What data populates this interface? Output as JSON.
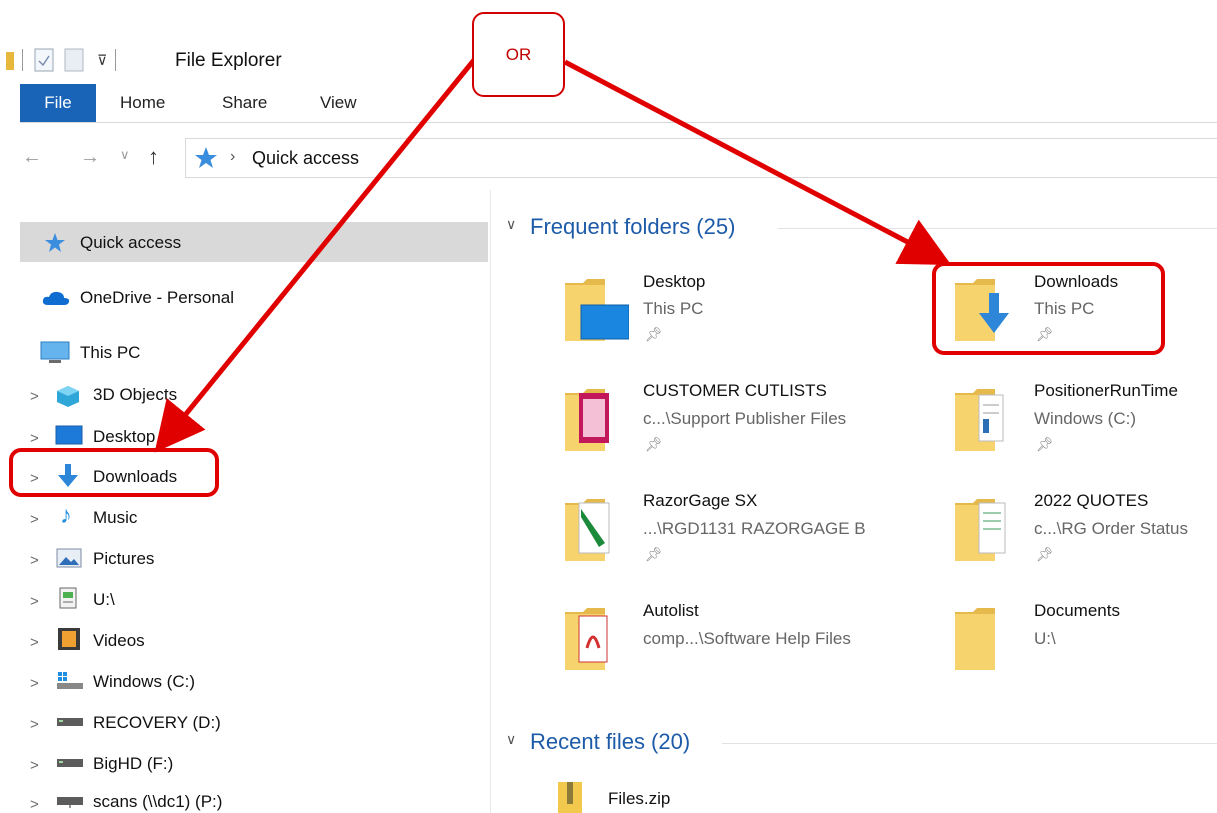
{
  "window": {
    "title": "File Explorer"
  },
  "ribbon": {
    "tabs": [
      "File",
      "Home",
      "Share",
      "View"
    ]
  },
  "address": {
    "path": "Quick access",
    "separator": "›"
  },
  "nav_pane": {
    "quick_access": "Quick access",
    "onedrive": "OneDrive - Personal",
    "this_pc": "This PC",
    "items": [
      {
        "label": "3D Objects",
        "icon": "3d-objects-icon"
      },
      {
        "label": "Desktop",
        "icon": "desktop-icon"
      },
      {
        "label": "Downloads",
        "icon": "downloads-icon"
      },
      {
        "label": "Music",
        "icon": "music-icon"
      },
      {
        "label": "Pictures",
        "icon": "pictures-icon"
      },
      {
        "label": "U:\\",
        "icon": "network-drive-icon"
      },
      {
        "label": "Videos",
        "icon": "videos-icon"
      },
      {
        "label": "Windows (C:)",
        "icon": "windows-drive-icon"
      },
      {
        "label": "RECOVERY (D:)",
        "icon": "drive-icon"
      },
      {
        "label": "BigHD (F:)",
        "icon": "drive-icon"
      },
      {
        "label": "scans (\\\\dc1) (P:)",
        "icon": "network-drive-icon"
      }
    ]
  },
  "frequent_folders": {
    "title": "Frequent folders (25)",
    "items": [
      {
        "name": "Desktop",
        "location": "This PC",
        "pinned": true,
        "overlay": "desktop"
      },
      {
        "name": "Downloads",
        "location": "This PC",
        "pinned": true,
        "overlay": "download-arrow"
      },
      {
        "name": "CUSTOMER CUTLISTS",
        "location": "c...\\Support Publisher Files",
        "pinned": true,
        "overlay": "publisher"
      },
      {
        "name": "PositionerRunTime",
        "location": "Windows (C:)",
        "pinned": true,
        "overlay": "document"
      },
      {
        "name": "RazorGage SX",
        "location": "...\\RGD1131 RAZORGAGE B",
        "pinned": true,
        "overlay": "image"
      },
      {
        "name": "2022 QUOTES",
        "location": "c...\\RG Order Status",
        "pinned": true,
        "overlay": "sheet"
      },
      {
        "name": "Autolist",
        "location": "comp...\\Software Help Files",
        "pinned": false,
        "overlay": "pdf"
      },
      {
        "name": "Documents",
        "location": "U:\\",
        "pinned": false,
        "overlay": "none"
      }
    ]
  },
  "recent_files": {
    "title": "Recent files (20)",
    "items": [
      {
        "name": "Files.zip",
        "icon": "zip-folder-icon"
      }
    ]
  },
  "annotation": {
    "label": "OR",
    "color": "#e00000"
  },
  "colors": {
    "accent": "#1a64b8",
    "group_title": "#1d5ba8",
    "annotation": "#e00000"
  }
}
